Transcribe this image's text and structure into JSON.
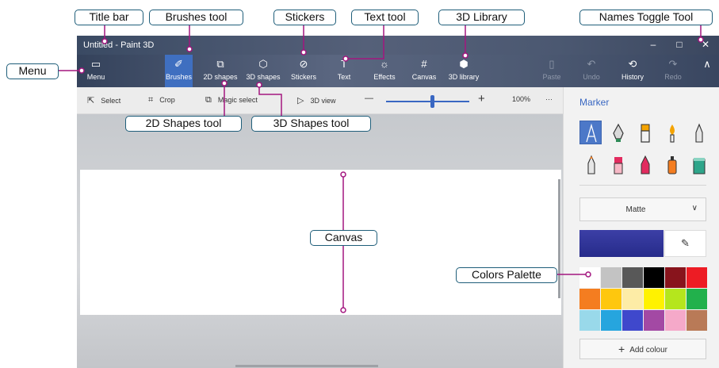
{
  "window": {
    "title": "Untitled - Paint 3D",
    "controls": [
      "–",
      "□",
      "✕"
    ]
  },
  "ribbon": {
    "menu": "Menu",
    "tools": [
      {
        "label": "Brushes",
        "icon": "✐"
      },
      {
        "label": "2D shapes",
        "icon": "⧉"
      },
      {
        "label": "3D shapes",
        "icon": "⬡"
      },
      {
        "label": "Stickers",
        "icon": "⊘"
      },
      {
        "label": "Text",
        "icon": "T"
      },
      {
        "label": "Effects",
        "icon": "☼"
      },
      {
        "label": "Canvas",
        "icon": "#"
      },
      {
        "label": "3D library",
        "icon": "⬢"
      }
    ],
    "actions": [
      {
        "label": "Paste",
        "icon": "▯"
      },
      {
        "label": "Undo",
        "icon": "↶"
      },
      {
        "label": "History",
        "icon": "⟲"
      },
      {
        "label": "Redo",
        "icon": "↷"
      }
    ],
    "collapse_icon": "∧"
  },
  "toolbar": {
    "select": "Select",
    "crop": "Crop",
    "magic_select": "Magic select",
    "view_3d": "3D view",
    "zoom_minus": "—",
    "zoom_plus": "+",
    "zoom": "100%",
    "more": "···",
    "zoom_level": 0.55
  },
  "panel": {
    "title": "Marker",
    "finish": "Matte",
    "add_colour": "Add colour",
    "brushes": [
      "marker",
      "calligraphy-pen",
      "oil-brush",
      "watercolor",
      "pencil",
      "crayon",
      "pixel-pen",
      "spray-can",
      "highlighter",
      "fill"
    ],
    "palette": [
      "#ffffff",
      "#c3c3c3",
      "#585858",
      "#000000",
      "#88141c",
      "#ed1c24",
      "#f47d20",
      "#fec70e",
      "#fdeca6",
      "#fff200",
      "#b5e61d",
      "#22b14c",
      "#99d9ea",
      "#26a5de",
      "#3f48cc",
      "#a349a4",
      "#f5a9c9",
      "#b97a57"
    ]
  },
  "callouts": {
    "title_bar": "Title bar",
    "brushes_tool": "Brushes tool",
    "stickers": "Stickers",
    "text_tool": "Text tool",
    "library_3d": "3D Library",
    "names_toggle": "Names Toggle Tool",
    "menu": "Menu",
    "shapes_2d": "2D Shapes tool",
    "shapes_3d": "3D Shapes tool",
    "canvas": "Canvas",
    "colors_palette": "Colors Palette"
  },
  "colors": {
    "callout_line": "#a3167f",
    "callout_border": "#1f5e7a",
    "accent": "#3967c2"
  }
}
